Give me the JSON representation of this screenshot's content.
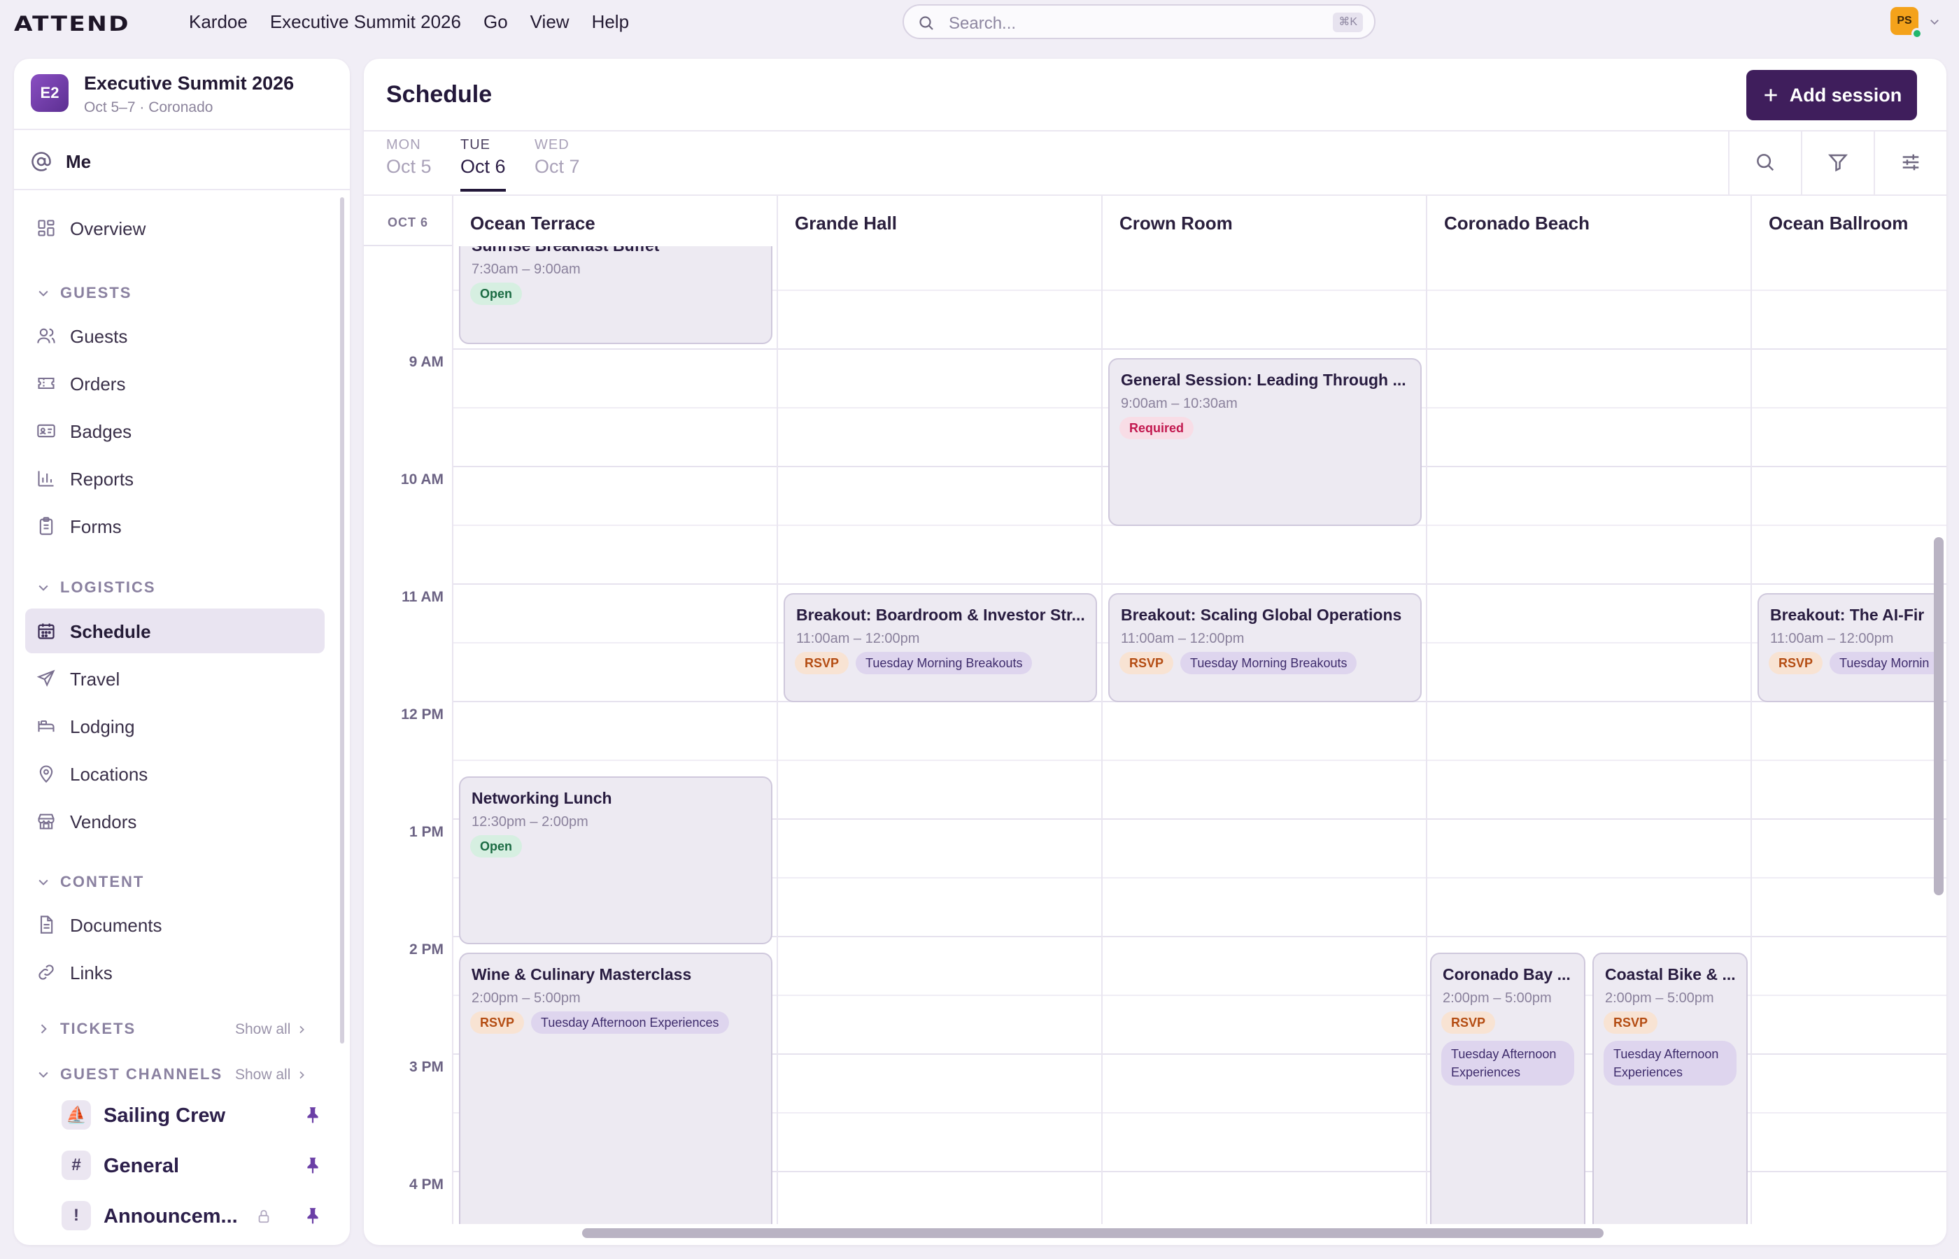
{
  "app": {
    "logo": "ATTEND",
    "menu": [
      "Kardoe",
      "Executive Summit 2026",
      "Go",
      "View",
      "Help"
    ],
    "search": {
      "placeholder": "Search...",
      "shortcut": "⌘K"
    },
    "user_initials": "PS"
  },
  "sidebar": {
    "event": {
      "badge": "E2",
      "title": "Executive Summit 2026",
      "subtitle": "Oct 5–7 · Coronado"
    },
    "me_label": "Me",
    "overview": "Overview",
    "sections": {
      "guests": "GUESTS",
      "logistics": "LOGISTICS",
      "content": "CONTENT",
      "tickets": "TICKETS",
      "channels": "GUEST CHANNELS"
    },
    "guests_items": [
      "Guests",
      "Orders",
      "Badges",
      "Reports",
      "Forms"
    ],
    "logistics_items": [
      "Schedule",
      "Travel",
      "Lodging",
      "Locations",
      "Vendors"
    ],
    "content_items": [
      "Documents",
      "Links"
    ],
    "show_all": "Show all",
    "channels": [
      {
        "icon": "⛵",
        "name": "Sailing Crew"
      },
      {
        "icon": "#",
        "name": "General"
      },
      {
        "icon": "!",
        "name": "Announcem..."
      }
    ]
  },
  "schedule": {
    "title": "Schedule",
    "add_label": "Add session",
    "days": [
      {
        "name": "MON",
        "date": "Oct 5"
      },
      {
        "name": "TUE",
        "date": "Oct 6"
      },
      {
        "name": "WED",
        "date": "Oct 7"
      }
    ],
    "date_label": "OCT 6",
    "columns": [
      "Ocean Terrace",
      "Grande Hall",
      "Crown Room",
      "Coronado Beach",
      "Ocean Ballroom"
    ],
    "times": [
      "9 AM",
      "10 AM",
      "11 AM",
      "12 PM",
      "1 PM",
      "2 PM",
      "3 PM",
      "4 PM"
    ],
    "events": [
      {
        "title": "Sunrise Breakfast Buffet",
        "time": "7:30am – 9:00am",
        "tags": [
          "Open"
        ]
      },
      {
        "title": "General Session: Leading Through ...",
        "time": "9:00am – 10:30am",
        "tags": [
          "Required"
        ]
      },
      {
        "title": "Breakout: Boardroom & Investor Str...",
        "time": "11:00am – 12:00pm",
        "tags": [
          "RSVP",
          "Tuesday Morning Breakouts"
        ]
      },
      {
        "title": "Breakout: Scaling Global Operations",
        "time": "11:00am – 12:00pm",
        "tags": [
          "RSVP",
          "Tuesday Morning Breakouts"
        ]
      },
      {
        "title": "Breakout: The AI-Fir",
        "time": "11:00am – 12:00pm",
        "tags": [
          "RSVP",
          "Tuesday Mornin"
        ]
      },
      {
        "title": "Networking Lunch",
        "time": "12:30pm – 2:00pm",
        "tags": [
          "Open"
        ]
      },
      {
        "title": "Wine & Culinary Masterclass",
        "time": "2:00pm – 5:00pm",
        "tags": [
          "RSVP",
          "Tuesday Afternoon Experiences"
        ]
      },
      {
        "title": "Coronado Bay ...",
        "time": "2:00pm – 5:00pm",
        "tags": [
          "RSVP",
          "Tuesday Afternoon Experiences"
        ]
      },
      {
        "title": "Coastal Bike & ...",
        "time": "2:00pm – 5:00pm",
        "tags": [
          "RSVP",
          "Tuesday Afternoon Experiences"
        ]
      }
    ]
  },
  "colors": {
    "accent": "#3f1e5c",
    "active_bg": "#e9e4f1",
    "event_bg": "#edeaf2"
  }
}
